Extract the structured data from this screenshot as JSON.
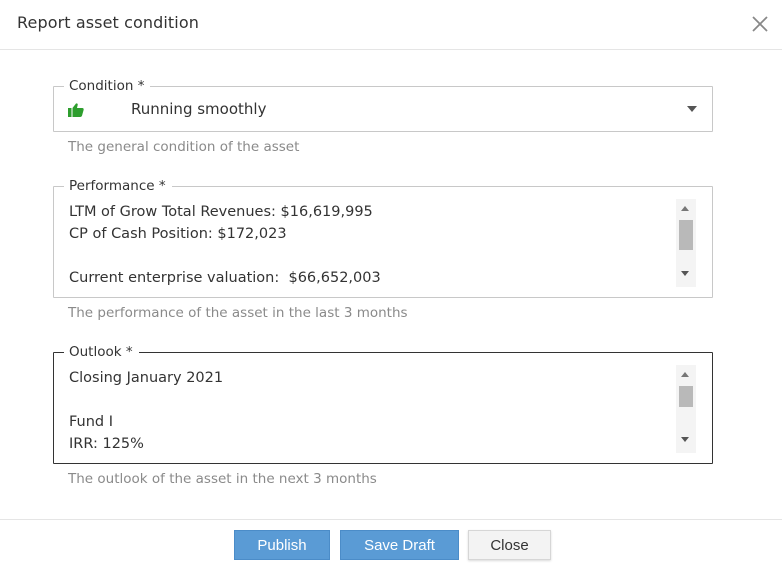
{
  "dialog": {
    "title": "Report asset condition",
    "close_icon": "close-icon"
  },
  "condition": {
    "label": "Condition *",
    "icon": "thumbs-up-icon",
    "icon_color": "#2e9e2e",
    "value": "Running smoothly",
    "help": "The general condition of the asset"
  },
  "performance": {
    "label": "Performance *",
    "value": "LTM of Grow Total Revenues: $16,619,995\nCP of Cash Position: $172,023\n\nCurrent enterprise valuation:  $66,652,003",
    "help": "The performance of the asset in the last 3 months"
  },
  "outlook": {
    "label": "Outlook *",
    "value": "Closing January 2021\n\nFund I\nIRR: 125%",
    "help": "The outlook of the asset in the next 3 months"
  },
  "footer": {
    "publish_label": "Publish",
    "save_draft_label": "Save Draft",
    "close_label": "Close",
    "primary_color": "#5a9bd5"
  }
}
